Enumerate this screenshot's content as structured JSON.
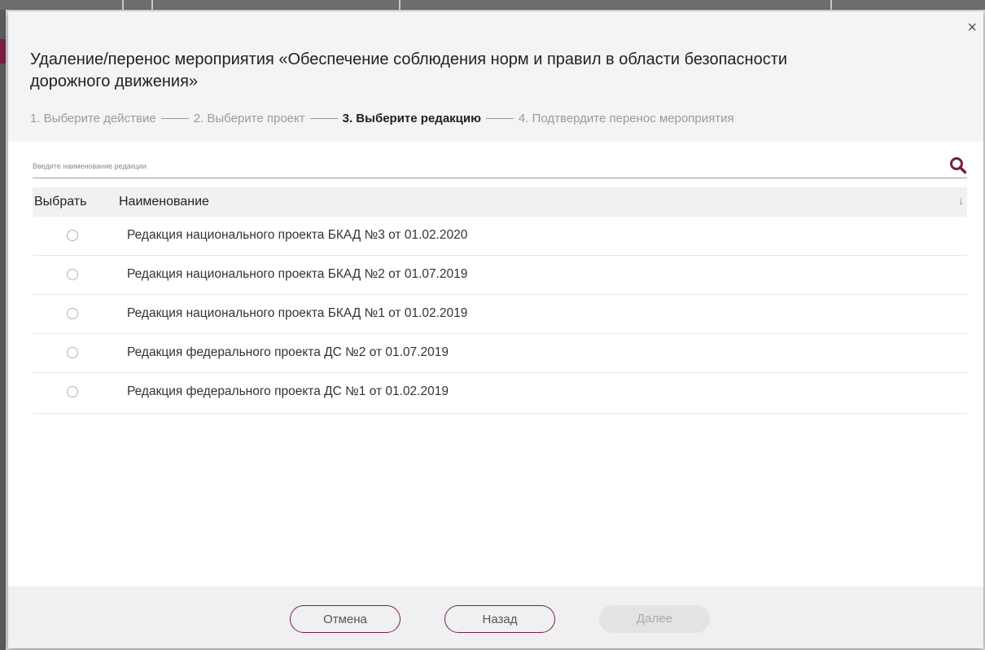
{
  "dialog": {
    "title": "Удаление/перенос мероприятия «Обеспечение соблюдения норм и правил в области безопасности дорожного движения»",
    "close_label": "×",
    "steps": [
      {
        "label": "1. Выберите действие",
        "active": false
      },
      {
        "label": "2. Выберите проект",
        "active": false
      },
      {
        "label": "3. Выберите редакцию",
        "active": true
      },
      {
        "label": "4. Подтвердите перенос мероприятия",
        "active": false
      }
    ]
  },
  "search": {
    "placeholder": "Введите наименование редакции",
    "value": "",
    "icon": "search-icon"
  },
  "table": {
    "columns": {
      "select": "Выбрать",
      "name": "Наименование"
    },
    "sort_icon": "↓",
    "rows": [
      {
        "selected": false,
        "name": "Редакция национального проекта БКАД №3 от 01.02.2020"
      },
      {
        "selected": false,
        "name": "Редакция национального проекта БКАД №2 от 01.07.2019"
      },
      {
        "selected": false,
        "name": "Редакция национального проекта БКАД №1 от 01.02.2019"
      },
      {
        "selected": false,
        "name": "Редакция федерального проекта ДС №2 от 01.07.2019"
      },
      {
        "selected": false,
        "name": "Редакция федерального проекта ДС №1 от 01.02.2019"
      }
    ]
  },
  "footer": {
    "cancel_label": "Отмена",
    "back_label": "Назад",
    "next_label": "Далее",
    "next_disabled": true
  },
  "colors": {
    "accent": "#7a1f45",
    "header_bg": "#f4f4f6",
    "footer_bg": "#f0f0f2",
    "disabled_button": "#e3e3e5"
  }
}
